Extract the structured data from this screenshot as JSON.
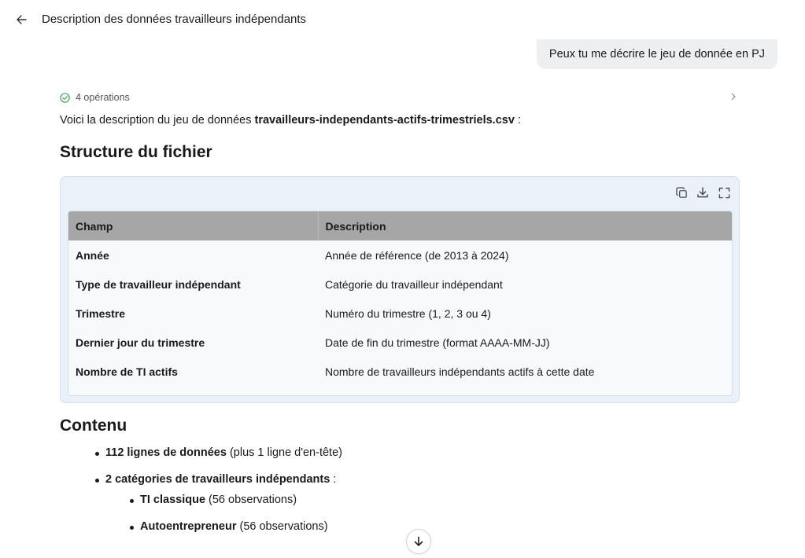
{
  "header": {
    "title": "Description des données travailleurs indépendants"
  },
  "user_message": "Peux tu me décrire le jeu de donnée en PJ",
  "operations": {
    "label": "4 opérations"
  },
  "intro": {
    "prefix": "Voici la description du jeu de données ",
    "filename": "travailleurs-independants-actifs-trimestriels.csv",
    "suffix": " :"
  },
  "sections": {
    "structure": "Structure du fichier",
    "contenu": "Contenu"
  },
  "table": {
    "headers": [
      "Champ",
      "Description"
    ],
    "rows": [
      [
        "Année",
        "Année de référence (de 2013 à 2024)"
      ],
      [
        "Type de travailleur indépendant",
        "Catégorie du travailleur indépendant"
      ],
      [
        "Trimestre",
        "Numéro du trimestre (1, 2, 3 ou 4)"
      ],
      [
        "Dernier jour du trimestre",
        "Date de fin du trimestre (format AAAA-MM-JJ)"
      ],
      [
        "Nombre de TI actifs",
        "Nombre de travailleurs indépendants actifs à cette date"
      ]
    ]
  },
  "content_list": [
    {
      "bold": "112 lignes de données",
      "rest": " (plus 1 ligne d'en-tête)"
    },
    {
      "bold": "2 catégories de travailleurs indépendants",
      "rest": " :"
    }
  ],
  "sub_list": [
    {
      "bold": "TI classique",
      "rest": " (56 observations)"
    },
    {
      "bold": "Autoentrepreneur",
      "rest": " (56 observations)"
    }
  ],
  "icons": {
    "back": "arrow-left-icon",
    "ops_status": "check-circle-icon",
    "ops_expand": "chevron-right-icon",
    "copy": "copy-icon",
    "download": "download-icon",
    "fullscreen": "fullscreen-icon",
    "scroll": "arrow-down-icon"
  },
  "colors": {
    "success": "#3aa757",
    "card_bg": "#eaf1f8",
    "table_header_bg": "#a6a6a6"
  }
}
